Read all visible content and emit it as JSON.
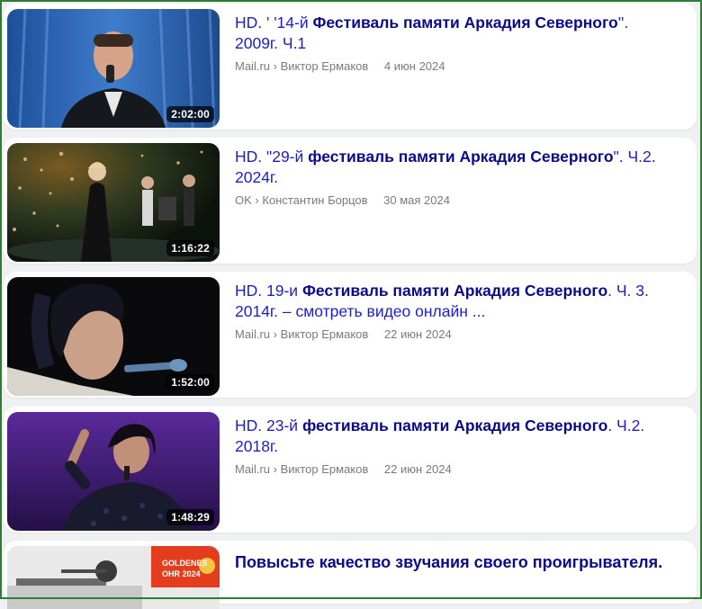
{
  "results": [
    {
      "title_prefix": "HD. ' '14-й ",
      "title_bold": "Фестиваль памяти Аркадия Северного",
      "title_suffix": "''. 2009г. Ч.1",
      "source": "Mail.ru",
      "sep": "›",
      "author": "Виктор Ермаков",
      "date": "4 июн 2024",
      "duration": "2:02:00"
    },
    {
      "title_prefix": "HD. \"29-й ",
      "title_bold": "фестиваль памяти Аркадия Северного",
      "title_suffix": "\". Ч.2. 2024г.",
      "source": "OK",
      "sep": "›",
      "author": "Константин Борцов",
      "date": "30 мая 2024",
      "duration": "1:16:22"
    },
    {
      "title_prefix": "HD. 19-и ",
      "title_bold": "Фестиваль памяти Аркадия Северного",
      "title_suffix": ". Ч. 3. 2014г. – смотреть видео онлайн ...",
      "source": "Mail.ru",
      "sep": "›",
      "author": "Виктор Ермаков",
      "date": "22 июн 2024",
      "duration": "1:52:00"
    },
    {
      "title_prefix": "HD. 23-й ",
      "title_bold": "фестиваль памяти Аркадия Северного",
      "title_suffix": ". Ч.2. 2018г.",
      "source": "Mail.ru",
      "sep": "›",
      "author": "Виктор Ермаков",
      "date": "22 июн 2024",
      "duration": "1:48:29"
    }
  ],
  "ad": {
    "title": "Повысьте качество звучания своего проигрывателя.",
    "badge_line1": "GOLDENES",
    "badge_line2": "OHR 2024"
  },
  "colors": {
    "title": "#0b0b8a",
    "meta": "#7a7a7a",
    "frame": "#2f7d32"
  }
}
